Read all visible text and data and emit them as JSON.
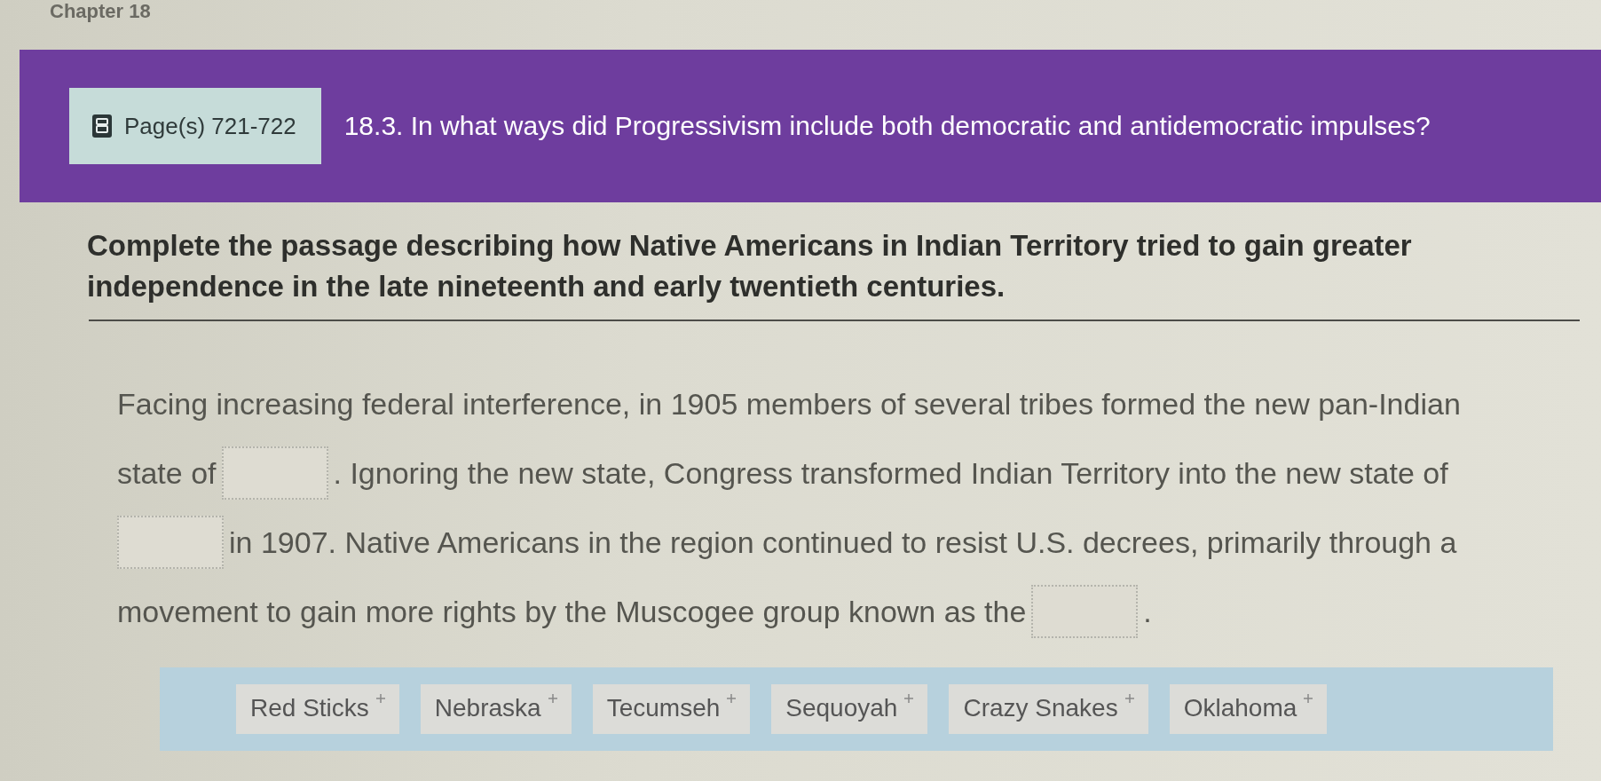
{
  "chapter_heading": "Chapter 18",
  "banner": {
    "page_ref": "Page(s) 721-722",
    "question": "18.3. In what ways did Progressivism include both democratic and antidemocratic impulses?"
  },
  "instructions": "Complete the passage describing how Native Americans in Indian Territory tried to gain greater independence in the late nineteenth and early twentieth centuries.",
  "passage": {
    "lines": [
      [
        {
          "kind": "text",
          "text": "Facing increasing federal interference, in 1905 members of several tribes formed the new pan-Indian"
        }
      ],
      [
        {
          "kind": "text",
          "text": "state of"
        },
        {
          "kind": "blank"
        },
        {
          "kind": "text",
          "text": ". Ignoring the new state, Congress transformed Indian Territory into the new state of"
        }
      ],
      [
        {
          "kind": "blank"
        },
        {
          "kind": "text",
          "text": "in 1907. Native Americans in the region continued to resist U.S. decrees, primarily through a"
        }
      ],
      [
        {
          "kind": "text",
          "text": "movement to gain more rights by the Muscogee group known as the"
        },
        {
          "kind": "blank"
        },
        {
          "kind": "text",
          "text": "."
        }
      ]
    ]
  },
  "word_bank": [
    "Red Sticks",
    "Nebraska",
    "Tecumseh",
    "Sequoyah",
    "Crazy Snakes",
    "Oklahoma"
  ]
}
